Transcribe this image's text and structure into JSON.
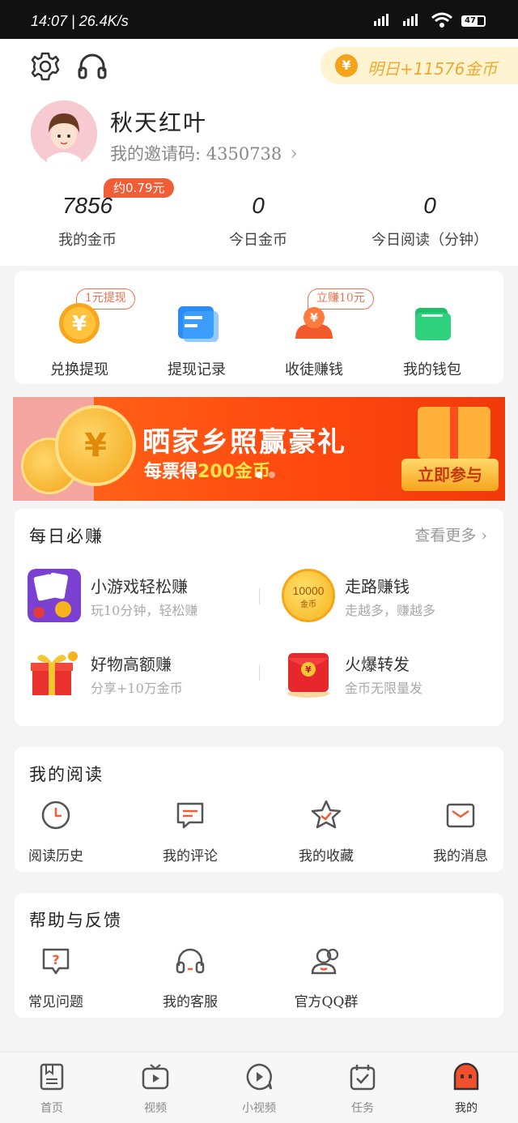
{
  "status_bar": {
    "time": "14:07 | 26.4K/s",
    "battery": "47"
  },
  "header": {
    "reward_text": "明日+11576金币",
    "reward_icon": "yen-coin-icon",
    "username": "秋天红叶",
    "invite_label": "我的邀请码: 4350738",
    "cash_badge": "约0.79元"
  },
  "stats": [
    {
      "value": "7856",
      "label": "我的金币"
    },
    {
      "value": "0",
      "label": "今日金币"
    },
    {
      "value": "0",
      "label": "今日阅读（分钟）"
    }
  ],
  "quick_actions": [
    {
      "label": "兑换提现",
      "tag": "1元提现",
      "icon": "yen-coin-icon"
    },
    {
      "label": "提现记录",
      "icon": "document-icon"
    },
    {
      "label": "收徒赚钱",
      "tag": "立赚10元",
      "icon": "user-coin-icon"
    },
    {
      "label": "我的钱包",
      "icon": "wallet-icon"
    }
  ],
  "banner": {
    "title": "晒家乡照赢豪礼",
    "sub_prefix": "每票得",
    "sub_highlight": "200金币",
    "button": "立即参与",
    "coin_symbol": "¥"
  },
  "daily": {
    "title": "每日必赚",
    "more": "查看更多",
    "tasks": [
      {
        "title": "小游戏轻松赚",
        "sub": "玩10分钟，轻松赚",
        "icon": "cards-game-icon"
      },
      {
        "title": "走路赚钱",
        "sub": "走越多，赚越多",
        "icon": "coin-10000-icon",
        "coin_text": "10000",
        "coin_sub": "金币"
      },
      {
        "title": "好物高额赚",
        "sub": "分享+10万金币",
        "icon": "gift-box-icon"
      },
      {
        "title": "火爆转发",
        "sub": "金币无限量发",
        "icon": "red-envelope-icon"
      }
    ]
  },
  "reading": {
    "title": "我的阅读",
    "items": [
      {
        "label": "阅读历史",
        "icon": "clock-icon"
      },
      {
        "label": "我的评论",
        "icon": "comment-icon"
      },
      {
        "label": "我的收藏",
        "icon": "star-icon"
      },
      {
        "label": "我的消息",
        "icon": "mail-icon"
      }
    ]
  },
  "help": {
    "title": "帮助与反馈",
    "items": [
      {
        "label": "常见问题",
        "icon": "question-icon"
      },
      {
        "label": "我的客服",
        "icon": "headset-icon"
      },
      {
        "label": "官方QQ群",
        "icon": "group-icon"
      }
    ]
  },
  "nav": [
    {
      "label": "首页",
      "icon": "book-icon"
    },
    {
      "label": "视频",
      "icon": "tv-icon"
    },
    {
      "label": "小视频",
      "icon": "play-bubble-icon"
    },
    {
      "label": "任务",
      "icon": "calendar-check-icon"
    },
    {
      "label": "我的",
      "icon": "profile-ghost-icon",
      "active": true
    }
  ],
  "colors": {
    "accent": "#f05d36",
    "gold": "#f4a31a",
    "banner": "#ff4a10"
  }
}
